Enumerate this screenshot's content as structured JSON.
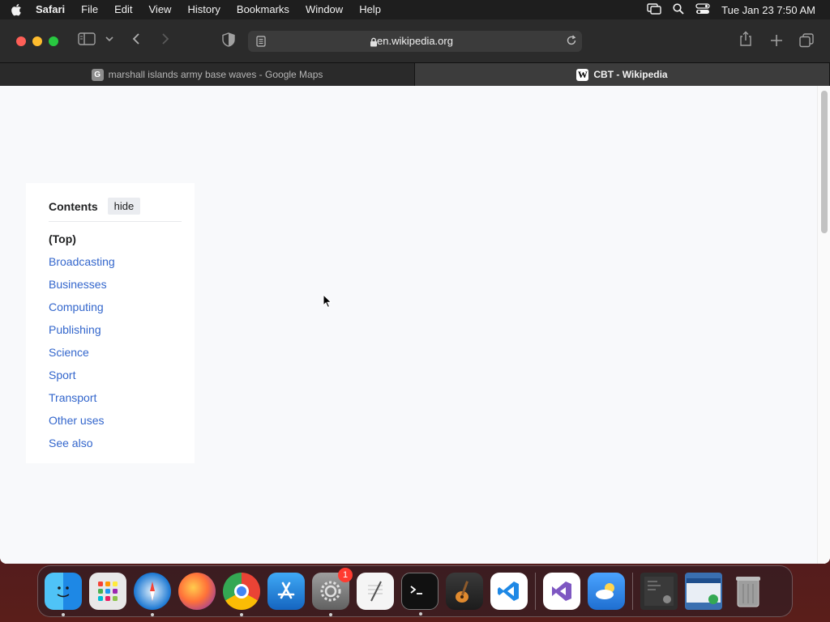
{
  "menubar": {
    "app_name": "Safari",
    "menus": [
      "File",
      "Edit",
      "View",
      "History",
      "Bookmarks",
      "Window",
      "Help"
    ],
    "clock": "Tue Jan 23  7:50 AM"
  },
  "browser": {
    "url": "en.wikipedia.org",
    "tabs": [
      {
        "label": "marshall islands army base waves - Google Maps",
        "favicon": "G",
        "active": false
      },
      {
        "label": "CBT - Wikipedia",
        "favicon": "W",
        "active": true
      }
    ]
  },
  "toc": {
    "title": "Contents",
    "hide_label": "hide",
    "items": [
      "(Top)",
      "Broadcasting",
      "Businesses",
      "Computing",
      "Publishing",
      "Science",
      "Sport",
      "Transport",
      "Other uses",
      "See also"
    ]
  },
  "dock": {
    "apps": [
      {
        "name": "finder-icon",
        "color": "#1e88e5"
      },
      {
        "name": "launchpad-icon",
        "color": "#e0e0e0"
      },
      {
        "name": "safari-icon",
        "color": "#1976d2"
      },
      {
        "name": "firefox-icon",
        "color": "#ff7139"
      },
      {
        "name": "chrome-icon",
        "color": "#34a853"
      },
      {
        "name": "app-store-icon",
        "color": "#1e90ff"
      },
      {
        "name": "system-settings-icon",
        "color": "#8e8e93",
        "badge": "1"
      },
      {
        "name": "textedit-icon",
        "color": "#f5f5f5"
      },
      {
        "name": "terminal-icon",
        "color": "#111111"
      },
      {
        "name": "garageband-icon",
        "color": "#2a2a2a"
      },
      {
        "name": "vscode-icon",
        "color": "#ffffff"
      },
      {
        "name": "visual-studio-icon",
        "color": "#ffffff"
      },
      {
        "name": "weather-icon",
        "color": "#2f7fd9"
      },
      {
        "name": "screenshot-thumbnail-1",
        "color": "#333333"
      },
      {
        "name": "screenshot-thumbnail-2",
        "color": "#3a6fb0"
      },
      {
        "name": "trash-icon",
        "color": "#9e9e9e"
      }
    ]
  }
}
